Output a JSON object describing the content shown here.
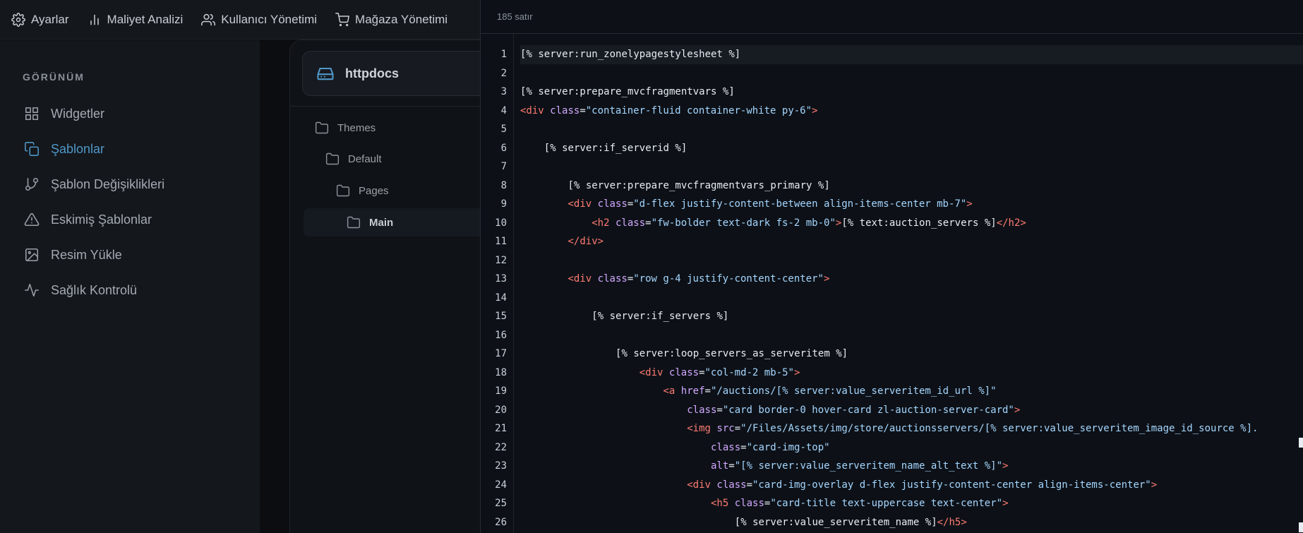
{
  "topnav": {
    "items": [
      {
        "label": "Ayarlar",
        "icon": "gear-icon"
      },
      {
        "label": "Maliyet Analizi",
        "icon": "bar-chart-icon"
      },
      {
        "label": "Kullanıcı Yönetimi",
        "icon": "users-icon"
      },
      {
        "label": "Mağaza Yönetimi",
        "icon": "cart-icon"
      }
    ]
  },
  "sidebar": {
    "section_title": "GÖRÜNÜM",
    "items": [
      {
        "label": "Widgetler",
        "icon": "grid-icon"
      },
      {
        "label": "Şablonlar",
        "icon": "copy-icon",
        "active": true
      },
      {
        "label": "Şablon Değişiklikleri",
        "icon": "git-branch-icon"
      },
      {
        "label": "Eskimiş Şablonlar",
        "icon": "warning-icon"
      },
      {
        "label": "Resim Yükle",
        "icon": "image-icon"
      },
      {
        "label": "Sağlık Kontrolü",
        "icon": "activity-icon"
      }
    ]
  },
  "tree": {
    "root": "httpdocs",
    "items": [
      {
        "label": "Themes"
      },
      {
        "label": "Default"
      },
      {
        "label": "Pages"
      },
      {
        "label": "Main",
        "selected": true
      }
    ]
  },
  "editor": {
    "line_count_label": "185 satır",
    "colors": {
      "tag": "#ff7b72",
      "attr": "#d2a8ff",
      "string": "#a5d6ff",
      "text": "#e6edf3"
    },
    "lines": [
      "[% server:run_zonelypagestylesheet %]",
      "",
      "[% server:prepare_mvcfragmentvars %]",
      "<div class=\"container-fluid container-white py-6\">",
      "",
      "    [% server:if_serverid %]",
      "",
      "        [% server:prepare_mvcfragmentvars_primary %]",
      "        <div class=\"d-flex justify-content-between align-items-center mb-7\">",
      "            <h2 class=\"fw-bolder text-dark fs-2 mb-0\">[% text:auction_servers %]</h2>",
      "        </div>",
      "",
      "        <div class=\"row g-4 justify-content-center\">",
      "",
      "            [% server:if_servers %]",
      "",
      "                [% server:loop_servers_as_serveritem %]",
      "                    <div class=\"col-md-2 mb-5\">",
      "                        <a href=\"/auctions/[% server:value_serveritem_id_url %]\"",
      "                            class=\"card border-0 hover-card zl-auction-server-card\">",
      "                            <img src=\"/Files/Assets/img/store/auctionsservers/[% server:value_serveritem_image_id_source %].",
      "                                class=\"card-img-top\"",
      "                                alt=\"[% server:value_serveritem_name_alt_text %]\">",
      "                            <div class=\"card-img-overlay d-flex justify-content-center align-items-center\">",
      "                                <h5 class=\"card-title text-uppercase text-center\">",
      "                                    [% server:value_serveritem_name %]</h5>"
    ]
  }
}
